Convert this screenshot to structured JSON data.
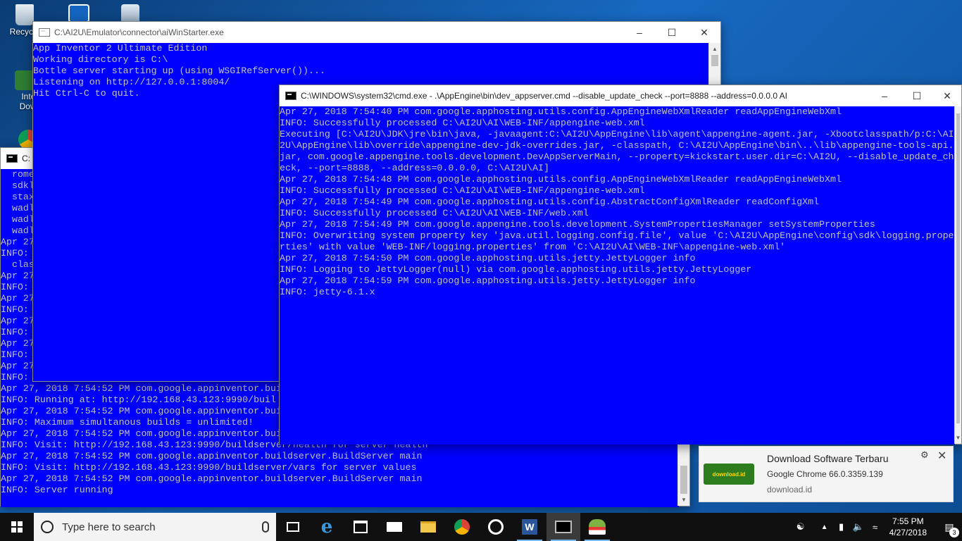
{
  "desktop": {
    "icons": [
      {
        "label": "Recycle"
      },
      {
        "label": "Intern"
      },
      {
        "label": "Downl"
      }
    ]
  },
  "window_ai_starter": {
    "title": "C:\\AI2U\\Emulator\\connector\\aiWinStarter.exe",
    "lines": [
      "App Inventor 2 Ultimate Edition",
      "Working directory is C:\\",
      "Bottle server starting up (using WSGIRefServer())...",
      "Listening on http://127.0.0.1:8004/",
      "Hit Ctrl-C to quit."
    ]
  },
  "window_buildserver": {
    "title": "C:",
    "lines": [
      "  rome",
      "  sdkl",
      "  stax",
      "  wadl",
      "  wadl",
      "  wadl",
      "Apr 27",
      "INFO:",
      "  clas",
      "Apr 27",
      "INFO:",
      "Apr 27",
      "INFO:",
      "Apr 27",
      "INFO:",
      "Apr 27",
      "INFO:",
      "Apr 27",
      "INFO:",
      "Apr 27, 2018 7:54:52 PM com.google.appinventor.bui",
      "INFO: Running at: http://192.168.43.123:9990/buil",
      "Apr 27, 2018 7:54:52 PM com.google.appinventor.bui",
      "INFO: Maximum simultanous builds = unlimited!",
      "Apr 27, 2018 7:54:52 PM com.google.appinventor.bui",
      "INFO: Visit: http://192.168.43.123:9990/buildserver/health for server health",
      "Apr 27, 2018 7:54:52 PM com.google.appinventor.buildserver.BuildServer main",
      "INFO: Visit: http://192.168.43.123:9990/buildserver/vars for server values",
      "Apr 27, 2018 7:54:52 PM com.google.appinventor.buildserver.BuildServer main",
      "INFO: Server running"
    ]
  },
  "window_appserver": {
    "title": "C:\\WINDOWS\\system32\\cmd.exe - .\\AppEngine\\bin\\dev_appserver.cmd   --disable_update_check --port=8888 --address=0.0.0.0 AI",
    "lines": [
      "Apr 27, 2018 7:54:40 PM com.google.apphosting.utils.config.AppEngineWebXmlReader readAppEngineWebXml",
      "INFO: Successfully processed C:\\AI2U\\AI\\WEB-INF/appengine-web.xml",
      "Executing [C:\\AI2U\\JDK\\jre\\bin\\java, -javaagent:C:\\AI2U\\AppEngine\\lib\\agent\\appengine-agent.jar, -Xbootclasspath/p:C:\\AI",
      "2U\\AppEngine\\lib\\override\\appengine-dev-jdk-overrides.jar, -classpath, C:\\AI2U\\AppEngine\\bin\\..\\lib\\appengine-tools-api.",
      "jar, com.google.appengine.tools.development.DevAppServerMain, --property=kickstart.user.dir=C:\\AI2U, --disable_update_ch",
      "eck, --port=8888, --address=0.0.0.0, C:\\AI2U\\AI]",
      "Apr 27, 2018 7:54:48 PM com.google.apphosting.utils.config.AppEngineWebXmlReader readAppEngineWebXml",
      "INFO: Successfully processed C:\\AI2U\\AI\\WEB-INF/appengine-web.xml",
      "Apr 27, 2018 7:54:49 PM com.google.apphosting.utils.config.AbstractConfigXmlReader readConfigXml",
      "INFO: Successfully processed C:\\AI2U\\AI\\WEB-INF/web.xml",
      "Apr 27, 2018 7:54:49 PM com.google.appengine.tools.development.SystemPropertiesManager setSystemProperties",
      "INFO: Overwriting system property key 'java.util.logging.config.file', value 'C:\\AI2U\\AppEngine\\config\\sdk\\logging.prope",
      "rties' with value 'WEB-INF/logging.properties' from 'C:\\AI2U\\AI\\WEB-INF\\appengine-web.xml'",
      "Apr 27, 2018 7:54:50 PM com.google.apphosting.utils.jetty.JettyLogger info",
      "INFO: Logging to JettyLogger(null) via com.google.apphosting.utils.jetty.JettyLogger",
      "Apr 27, 2018 7:54:59 PM com.google.apphosting.utils.jetty.JettyLogger info",
      "INFO: jetty-6.1.x"
    ]
  },
  "notification": {
    "title": "Download Software Terbaru",
    "subtitle": "Google Chrome 66.0.3359.139",
    "source": "download.id",
    "logo_text": "download.id"
  },
  "taskbar": {
    "search_placeholder": "Type here to search",
    "time": "7:55 PM",
    "date": "4/27/2018",
    "notification_count": "3"
  },
  "colors": {
    "console_bg": "#0000ff",
    "console_fg": "#c0c0c0",
    "taskbar_bg": "#101010"
  }
}
